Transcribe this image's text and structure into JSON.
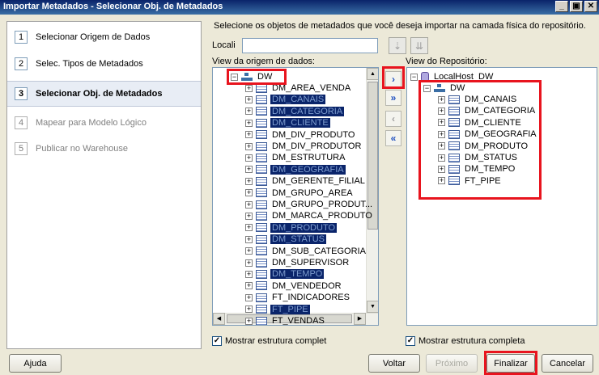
{
  "window": {
    "title": "Importar Metadados - Selecionar Obj. de Metadados",
    "min": "_",
    "restore": "▣",
    "close": "✕"
  },
  "steps": [
    {
      "num": "1",
      "label": "Selecionar Origem de Dados",
      "state": "done"
    },
    {
      "num": "2",
      "label": "Selec. Tipos de Metadados",
      "state": "done"
    },
    {
      "num": "3",
      "label": "Selecionar Obj. de Metadados",
      "state": "active"
    },
    {
      "num": "4",
      "label": "Mapear para Modelo Lógico",
      "state": "pending"
    },
    {
      "num": "5",
      "label": "Publicar no Warehouse",
      "state": "pending"
    }
  ],
  "instruction": "Selecione os objetos de metadados que você deseja importar na camada física do repositório.",
  "locali": {
    "label": "Locali",
    "value": ""
  },
  "source": {
    "label": "View da origem de dados:",
    "root": "DW",
    "items": [
      {
        "name": "DM_AREA_VENDA",
        "selected": false
      },
      {
        "name": "DM_CANAIS",
        "selected": true
      },
      {
        "name": "DM_CATEGORIA",
        "selected": true
      },
      {
        "name": "DM_CLIENTE",
        "selected": true
      },
      {
        "name": "DM_DIV_PRODUTO",
        "selected": false
      },
      {
        "name": "DM_DIV_PRODUTOR",
        "selected": false
      },
      {
        "name": "DM_ESTRUTURA",
        "selected": false
      },
      {
        "name": "DM_GEOGRAFIA",
        "selected": true
      },
      {
        "name": "DM_GERENTE_FILIAL",
        "selected": false
      },
      {
        "name": "DM_GRUPO_AREA",
        "selected": false
      },
      {
        "name": "DM_GRUPO_PRODUT...",
        "selected": false
      },
      {
        "name": "DM_MARCA_PRODUTO",
        "selected": false
      },
      {
        "name": "DM_PRODUTO",
        "selected": true
      },
      {
        "name": "DM_STATUS",
        "selected": true
      },
      {
        "name": "DM_SUB_CATEGORIA",
        "selected": false
      },
      {
        "name": "DM_SUPERVISOR",
        "selected": false
      },
      {
        "name": "DM_TEMPO",
        "selected": true
      },
      {
        "name": "DM_VENDEDOR",
        "selected": false
      },
      {
        "name": "FT_INDICADORES",
        "selected": false
      },
      {
        "name": "FT_PIPE",
        "selected": true
      },
      {
        "name": "FT_VENDAS",
        "selected": false
      }
    ],
    "checkbox": "Mostrar estrutura complet"
  },
  "repository": {
    "label": "View do Repositório:",
    "root": "LocalHost_DW",
    "child": "DW",
    "items": [
      "DM_CANAIS",
      "DM_CATEGORIA",
      "DM_CLIENTE",
      "DM_GEOGRAFIA",
      "DM_PRODUTO",
      "DM_STATUS",
      "DM_TEMPO",
      "FT_PIPE"
    ],
    "checkbox": "Mostrar estrutura completa"
  },
  "transfer": {
    "add": "›",
    "add_all": "»",
    "remove": "‹",
    "remove_all": "«"
  },
  "buttons": {
    "help": "Ajuda",
    "back": "Voltar",
    "next": "Próximo",
    "finish": "Finalizar",
    "cancel": "Cancelar"
  },
  "colors": {
    "selection": "#0a246a",
    "highlight_box": "#e8141e"
  }
}
